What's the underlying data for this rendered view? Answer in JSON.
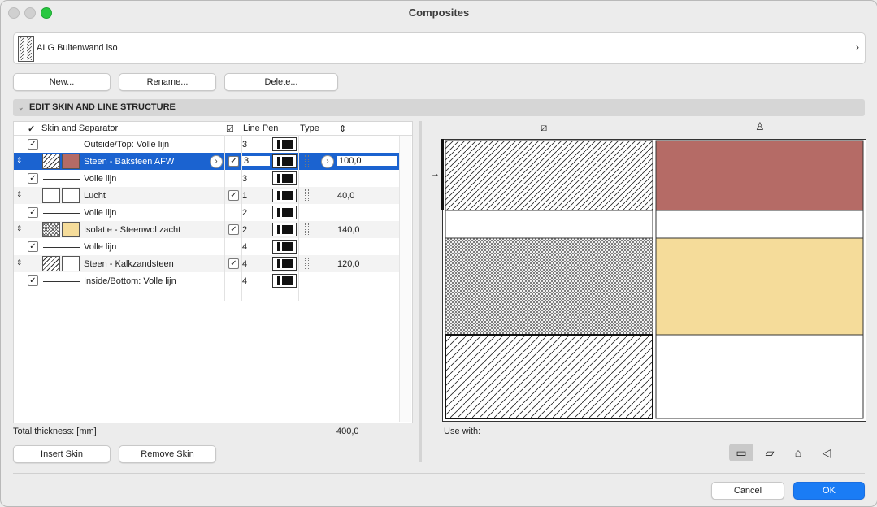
{
  "window": {
    "title": "Composites"
  },
  "composite": {
    "name": "ALG Buitenwand iso"
  },
  "actions": {
    "new": "New...",
    "rename": "Rename...",
    "delete": "Delete..."
  },
  "section": {
    "title": "EDIT SKIN AND LINE STRUCTURE"
  },
  "table": {
    "headers": {
      "check": "✓",
      "skin": "Skin and Separator",
      "check2": "☑",
      "linepen": "Line Pen",
      "type": "Type",
      "thickness": "⇕"
    },
    "rows": [
      {
        "kind": "line",
        "label": "Outside/Top: Volle lijn",
        "pen": "3"
      },
      {
        "kind": "skin",
        "label": "Steen - Baksteen AFW",
        "pen": "3",
        "thickness": "100,0",
        "color": "#b56b66",
        "hatch": "diag",
        "selected": true
      },
      {
        "kind": "line",
        "label": "Volle lijn",
        "pen": "3"
      },
      {
        "kind": "skin",
        "label": "Lucht",
        "pen": "1",
        "thickness": "40,0",
        "color": "#ffffff",
        "hatch": "none"
      },
      {
        "kind": "line",
        "label": "Volle lijn",
        "pen": "2"
      },
      {
        "kind": "skin",
        "label": "Isolatie - Steenwol zacht",
        "pen": "2",
        "thickness": "140,0",
        "color": "#f5dc9a",
        "hatch": "cross"
      },
      {
        "kind": "line",
        "label": "Volle lijn",
        "pen": "4"
      },
      {
        "kind": "skin",
        "label": "Steen - Kalkzandsteen",
        "pen": "4",
        "thickness": "120,0",
        "color": "#ffffff",
        "hatch": "diag"
      },
      {
        "kind": "line",
        "label": "Inside/Bottom: Volle lijn",
        "pen": "4"
      }
    ]
  },
  "total": {
    "label": "Total thickness: [mm]",
    "value": "400,0"
  },
  "skin_actions": {
    "insert": "Insert Skin",
    "remove": "Remove Skin"
  },
  "use_with": {
    "label": "Use with:"
  },
  "footer": {
    "cancel": "Cancel",
    "ok": "OK"
  },
  "colors": {
    "accent": "#1a7cf5",
    "selection": "#1b63d0",
    "brick": "#b56b66",
    "insulation": "#f5dc9a"
  }
}
